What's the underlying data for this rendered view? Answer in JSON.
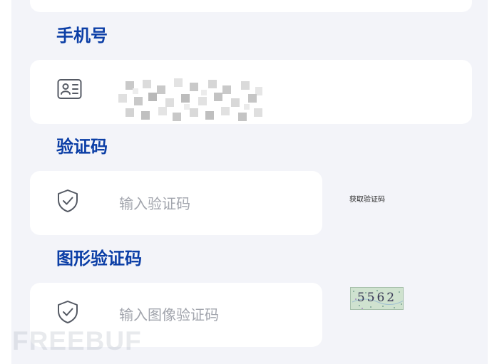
{
  "form": {
    "phone_label": "手机号",
    "sms_code_label": "验证码",
    "sms_code_placeholder": "输入验证码",
    "get_code_label": "获取验证码",
    "image_code_label": "图形验证码",
    "image_code_placeholder": "输入图像验证码",
    "captcha_text": "5562"
  },
  "icons": {
    "phone_field": "id-card-icon",
    "sms_field": "shield-check-icon",
    "image_field": "shield-check-icon"
  },
  "watermark": "FREEBUF",
  "colors": {
    "label_blue": "#0b3ea6",
    "placeholder_gray": "#a2a5ad",
    "panel_background": "#f3f4f9",
    "field_background": "#ffffff"
  }
}
